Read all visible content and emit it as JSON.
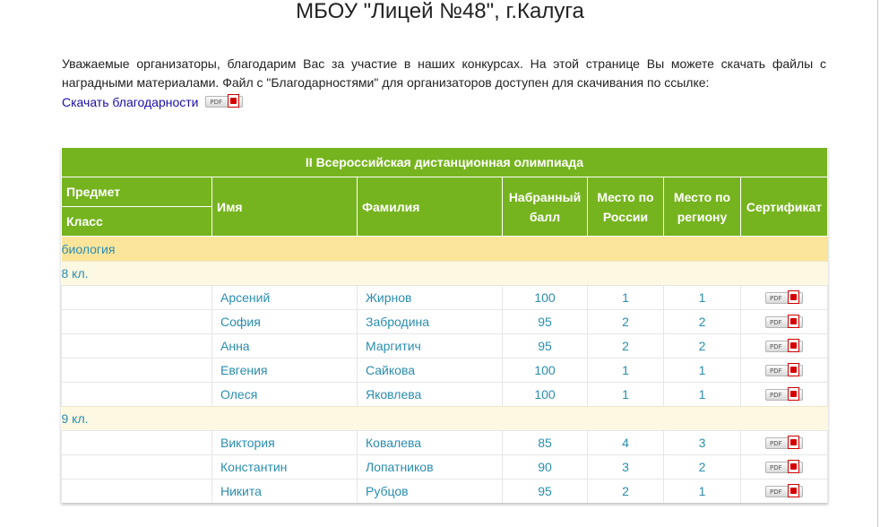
{
  "page": {
    "title": "МБОУ \"Лицей №48\", г.Калуга",
    "intro": "Уважаемые организаторы, благодарим Вас за участие в наших конкурсах. На этой странице Вы можете скачать файлы с наградными материалами. Файл с \"Благодарностями\" для организаторов доступен для скачивания по ссылке:",
    "download_link": "Скачать благодарности",
    "pdf_label": "PDF"
  },
  "table": {
    "caption": "II Всероссийская дистанционная олимпиада",
    "headers": {
      "subject": "Предмет",
      "class": "Класс",
      "first_name": "Имя",
      "last_name": "Фамилия",
      "score_1": "Набранный",
      "score_2": "балл",
      "rank_russia_1": "Место по",
      "rank_russia_2": "России",
      "rank_region_1": "Место по",
      "rank_region_2": "региону",
      "certificate": "Сертификат"
    },
    "subject": "биология",
    "groups": [
      {
        "class": "8 кл.",
        "rows": [
          {
            "first": "Арсений",
            "last": "Жирнов",
            "score": "100",
            "russia": "1",
            "region": "1"
          },
          {
            "first": "София",
            "last": "Забродина",
            "score": "95",
            "russia": "2",
            "region": "2"
          },
          {
            "first": "Анна",
            "last": "Маргитич",
            "score": "95",
            "russia": "2",
            "region": "2"
          },
          {
            "first": "Евгения",
            "last": "Сайкова",
            "score": "100",
            "russia": "1",
            "region": "1"
          },
          {
            "first": "Олеся",
            "last": "Яковлева",
            "score": "100",
            "russia": "1",
            "region": "1"
          }
        ]
      },
      {
        "class": "9 кл.",
        "rows": [
          {
            "first": "Виктория",
            "last": "Ковалева",
            "score": "85",
            "russia": "4",
            "region": "3"
          },
          {
            "first": "Константин",
            "last": "Лопатников",
            "score": "90",
            "russia": "3",
            "region": "2"
          },
          {
            "first": "Никита",
            "last": "Рубцов",
            "score": "95",
            "russia": "2",
            "region": "1"
          }
        ]
      }
    ]
  },
  "colors": {
    "header_green": "#76b41f",
    "subject_row": "#fbe59b",
    "class_row": "#fdf8e1",
    "link": "#1a0dab",
    "cell_text": "#2a8db0"
  }
}
